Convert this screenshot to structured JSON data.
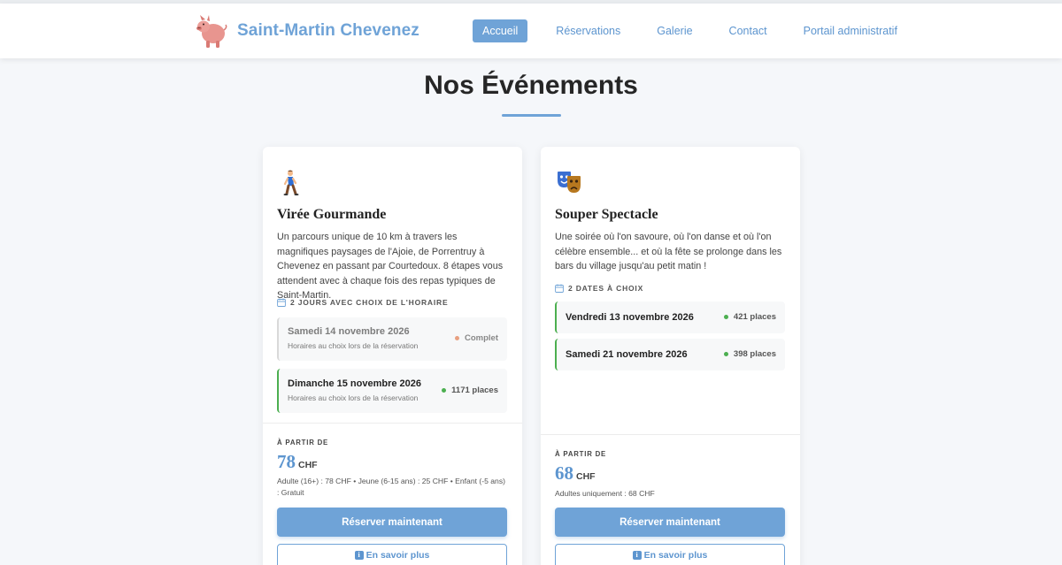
{
  "header": {
    "brand": "Saint-Martin Chevenez",
    "nav": [
      {
        "label": "Accueil",
        "active": true
      },
      {
        "label": "Réservations",
        "active": false
      },
      {
        "label": "Galerie",
        "active": false
      },
      {
        "label": "Contact",
        "active": false
      },
      {
        "label": "Portail administratif",
        "active": false
      }
    ]
  },
  "main": {
    "title": "Nos Événements",
    "events": [
      {
        "icon": "walking-person-icon",
        "title": "Virée Gourmande",
        "description": "Un parcours unique de 10 km à travers les magnifiques paysages de l'Ajoie, de Porrentruy à Chevenez en passant par Courtedoux. 8 étapes vous attendent avec à chaque fois des repas typiques de Saint-Martin.",
        "dates_label": "2 jours avec choix de l'horaire",
        "dates": [
          {
            "date": "Samedi 14 novembre 2026",
            "sub": "Horaires au choix lors de la réservation",
            "availability": "Complet",
            "full": true
          },
          {
            "date": "Dimanche 15 novembre 2026",
            "sub": "Horaires au choix lors de la réservation",
            "availability": "1171 places",
            "full": false
          }
        ],
        "from_label": "À PARTIR DE",
        "price": "78",
        "currency": "CHF",
        "price_detail": "Adulte (16+) : 78 CHF • Jeune (6-15 ans) : 25 CHF • Enfant (-5 ans) : Gratuit",
        "book_label": "Réserver maintenant",
        "more_label": "En savoir plus"
      },
      {
        "icon": "theater-masks-icon",
        "title": "Souper Spectacle",
        "description": "Une soirée où l'on savoure, où l'on danse et où l'on célèbre ensemble... et où la fête se prolonge dans les bars du village jusqu'au petit matin !",
        "dates_label": "2 dates à choix",
        "dates": [
          {
            "date": "Vendredi 13 novembre 2026",
            "availability": "421 places",
            "full": false
          },
          {
            "date": "Samedi 21 novembre 2026",
            "availability": "398 places",
            "full": false
          }
        ],
        "from_label": "À PARTIR DE",
        "price": "68",
        "currency": "CHF",
        "price_detail": "Adultes uniquement : 68 CHF",
        "book_label": "Réserver maintenant",
        "more_label": "En savoir plus"
      }
    ]
  },
  "colors": {
    "accent": "#6fa3d7",
    "available": "#4caf50",
    "full": "#e8a080"
  }
}
